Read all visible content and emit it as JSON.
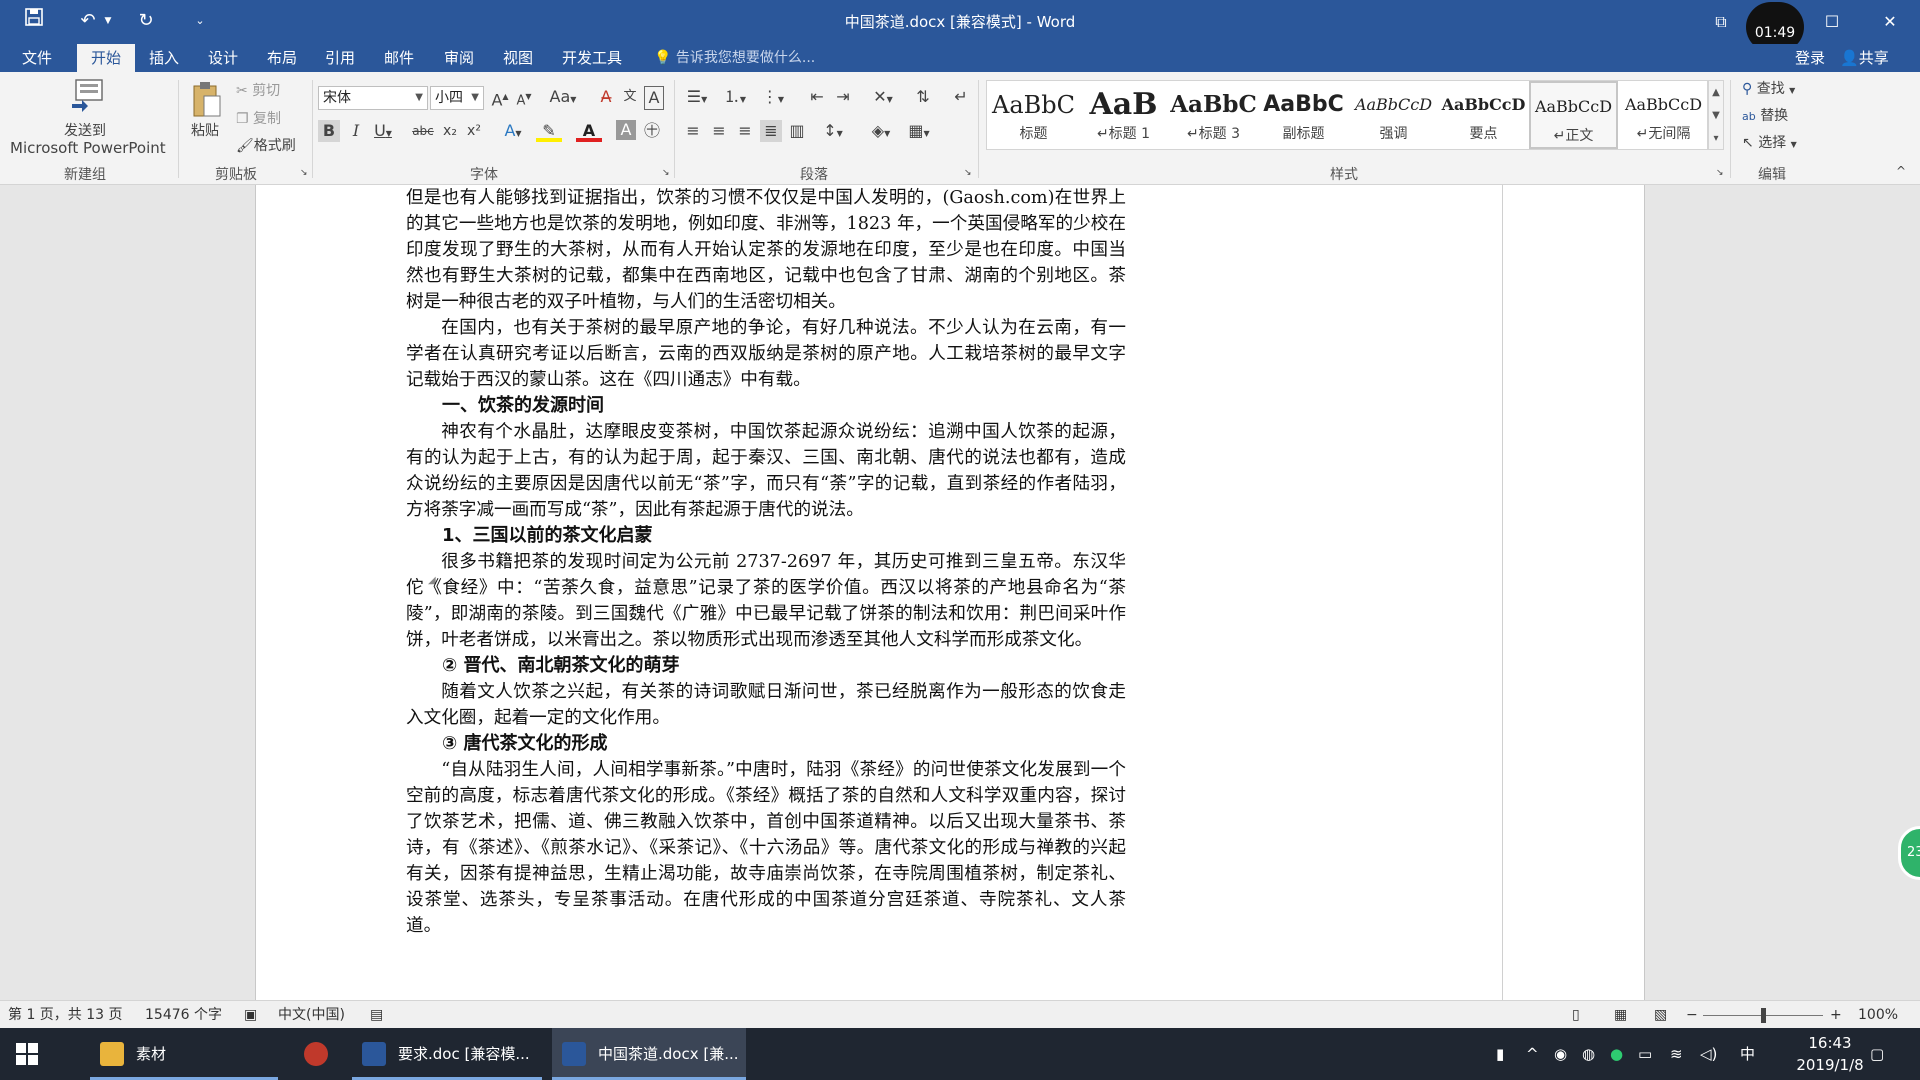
{
  "window": {
    "title": "中国茶道.docx [兼容模式] - Word",
    "clock": "01:49"
  },
  "tabs": [
    "文件",
    "开始",
    "插入",
    "设计",
    "布局",
    "引用",
    "邮件",
    "审阅",
    "视图",
    "开发工具"
  ],
  "tell_me": "告诉我您想要做什么...",
  "account": {
    "login": "登录",
    "share": "共享"
  },
  "ribbon": {
    "new_group": {
      "send_line1": "发送到",
      "send_line2": "Microsoft PowerPoint",
      "label": "新建组"
    },
    "clipboard": {
      "paste": "粘贴",
      "cut": "剪切",
      "copy": "复制",
      "painter": "格式刷",
      "label": "剪贴板"
    },
    "font": {
      "name": "宋体",
      "size": "小四",
      "label": "字体"
    },
    "paragraph": {
      "label": "段落"
    },
    "styles": {
      "label": "样式",
      "items": [
        {
          "sample": "AaBbC",
          "name": "标题"
        },
        {
          "sample": "AaB",
          "name": "↵标题 1"
        },
        {
          "sample": "AaBbC",
          "name": "↵标题 3"
        },
        {
          "sample": "AaBbC",
          "name": "副标题"
        },
        {
          "sample": "AaBbCcD",
          "name": "强调"
        },
        {
          "sample": "AaBbCcD",
          "name": "要点"
        },
        {
          "sample": "AaBbCcD",
          "name": "↵正文"
        },
        {
          "sample": "AaBbCcD",
          "name": "↵无间隔"
        }
      ]
    },
    "editing": {
      "find": "查找",
      "replace": "替换",
      "select": "选择",
      "label": "编辑"
    }
  },
  "document": {
    "para0": "但是也有人能够找到证据指出，饮茶的习惯不仅仅是中国人发明的，(Gaosh.com)在世界上的其它一些地方也是饮茶的发明地，例如印度、非洲等，1823 年，一个英国侵略军的少校在印度发现了野生的大茶树，从而有人开始认定茶的发源地在印度，至少是也在印度。中国当然也有野生大茶树的记载，都集中在西南地区，记载中也包含了甘肃、湖南的个别地区。茶树是一种很古老的双子叶植物，与人们的生活密切相关。",
    "para1": "在国内，也有关于茶树的最早原产地的争论，有好几种说法。不少人认为在云南，有一学者在认真研究考证以后断言，云南的西双版纳是茶树的原产地。人工栽培茶树的最早文字记载始于西汉的蒙山茶。这在《四川通志》中有载。",
    "heading1": "一、饮茶的发源时间",
    "para2": "神农有个水晶肚，达摩眼皮变茶树，中国饮茶起源众说纷纭：追溯中国人饮茶的起源，有的认为起于上古，有的认为起于周，起于秦汉、三国、南北朝、唐代的说法也都有，造成众说纷纭的主要原因是因唐代以前无“茶”字，而只有“荼”字的记载，直到茶经的作者陆羽，方将荼字减一画而写成“茶”，因此有茶起源于唐代的说法。",
    "heading2": "1、三国以前的茶文化启蒙",
    "para3": "很多书籍把茶的发现时间定为公元前 2737-2697 年，其历史可推到三皇五帝。东汉华佗《食经》中：“苦荼久食，益意思”记录了茶的医学价值。西汉以将茶的产地县命名为“茶陵”，即湖南的茶陵。到三国魏代《广雅》中已最早记载了饼茶的制法和饮用：荆巴间采叶作饼，叶老者饼成，以米膏出之。茶以物质形式出现而渗透至其他人文科学而形成茶文化。",
    "heading3": "② 晋代、南北朝茶文化的萌芽",
    "para4": "随着文人饮茶之兴起，有关茶的诗词歌赋日渐问世，茶已经脱离作为一般形态的饮食走入文化圈，起着一定的文化作用。",
    "heading4": "③ 唐代茶文化的形成",
    "para5": "“自从陆羽生人间，人间相学事新茶。”中唐时，陆羽《茶经》的问世使茶文化发展到一个空前的高度，标志着唐代茶文化的形成。《茶经》概括了茶的自然和人文科学双重内容，探讨了饮茶艺术，把儒、道、佛三教融入饮茶中，首创中国茶道精神。以后又出现大量茶书、茶诗，有《茶述》、《煎茶水记》、《采茶记》、《十六汤品》等。唐代茶文化的形成与禅教的兴起有关，因茶有提神益思，生精止渴功能，故寺庙崇尚饮茶，在寺院周围植茶树，制定茶礼、设茶堂、选茶头，专呈茶事活动。在唐代形成的中国茶道分宫廷茶道、寺院茶礼、文人茶道。"
  },
  "badge": "23",
  "status": {
    "page": "第 1 页，共 13 页",
    "words": "15476 个字",
    "language": "中文(中国)",
    "zoom": "100%",
    "zoom_level": 1.0
  },
  "taskbar": {
    "items": [
      "素材",
      "",
      "要求.doc [兼容模...",
      "中国茶道.docx [兼..."
    ],
    "ime": "中",
    "time": "16:43",
    "date": "2019/1/8"
  },
  "colors": {
    "accent": "#2b579a",
    "taskbar": "#1f2631"
  }
}
